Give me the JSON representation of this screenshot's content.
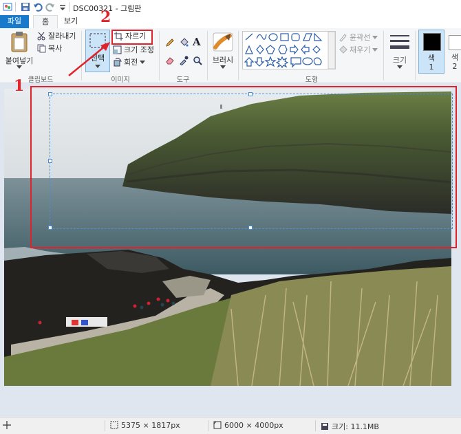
{
  "window": {
    "title": "DSC00321 - 그림판"
  },
  "tabs": {
    "file": "파일",
    "home": "홈",
    "view": "보기"
  },
  "ribbon": {
    "clipboard": {
      "paste": "붙여넣기",
      "cut": "잘라내기",
      "copy": "복사",
      "group_label": "클립보드"
    },
    "image": {
      "select": "선택",
      "crop": "자르기",
      "resize": "크기 조정",
      "rotate": "회전",
      "group_label": "이미지"
    },
    "tools": {
      "group_label": "도구"
    },
    "brushes": {
      "label": "브러시"
    },
    "shapes": {
      "outline": "윤곽선",
      "fill": "채우기",
      "group_label": "도형"
    },
    "size": {
      "label": "크기"
    },
    "colors": {
      "color1": "색\n1",
      "color2": "색\n2"
    }
  },
  "status": {
    "selection_size": "5375 × 1817px",
    "image_size": "6000 × 4000px",
    "file_size": "크기: 11.1MB"
  },
  "annotations": {
    "step1": "1",
    "step2": "2"
  },
  "colors": {
    "accent": "#1979ca",
    "annotation_red": "#e0222a",
    "selection_blue": "#cce4f7"
  }
}
